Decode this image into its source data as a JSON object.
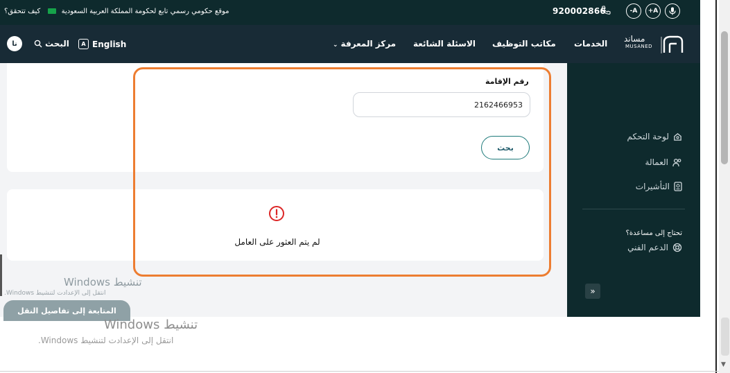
{
  "topbar": {
    "notice": "موقع حكومي رسمي تابع لحكومة المملكة العربية السعودية",
    "verify": "كيف تتحقق؟",
    "phone": "920002866",
    "acc_minus": "-A",
    "acc_plus": "+A"
  },
  "navbar": {
    "logo_ar": "مساند",
    "logo_en": "MUSANED",
    "items": [
      "الخدمات",
      "مكاتب التوظيف",
      "الاسئلة الشائعة",
      "مركز المعرفة"
    ],
    "language": "English",
    "search": "البحث",
    "login": "نا"
  },
  "sidebar": {
    "items": [
      "لوحة التحكم",
      "العمالة",
      "التأشيرات"
    ],
    "help_title": "تحتاج إلى مساعدة؟",
    "support": "الدعم الفني",
    "collapse": "»"
  },
  "form": {
    "label": "رقم الإقامة",
    "value": "2162466953",
    "search_button": "بحث"
  },
  "result": {
    "message": "لم يتم العثور على العامل"
  },
  "footer": {
    "continue_button": "المتابعة إلى تفاصيل النقل"
  },
  "watermark": {
    "title": "تنشيط Windows",
    "subtitle": "انتقل إلى الإعدادت لتنشيط Windows."
  },
  "colors": {
    "highlight": "#ed7d31",
    "brand_dark": "#0e2a2d",
    "error": "#dc2626"
  }
}
